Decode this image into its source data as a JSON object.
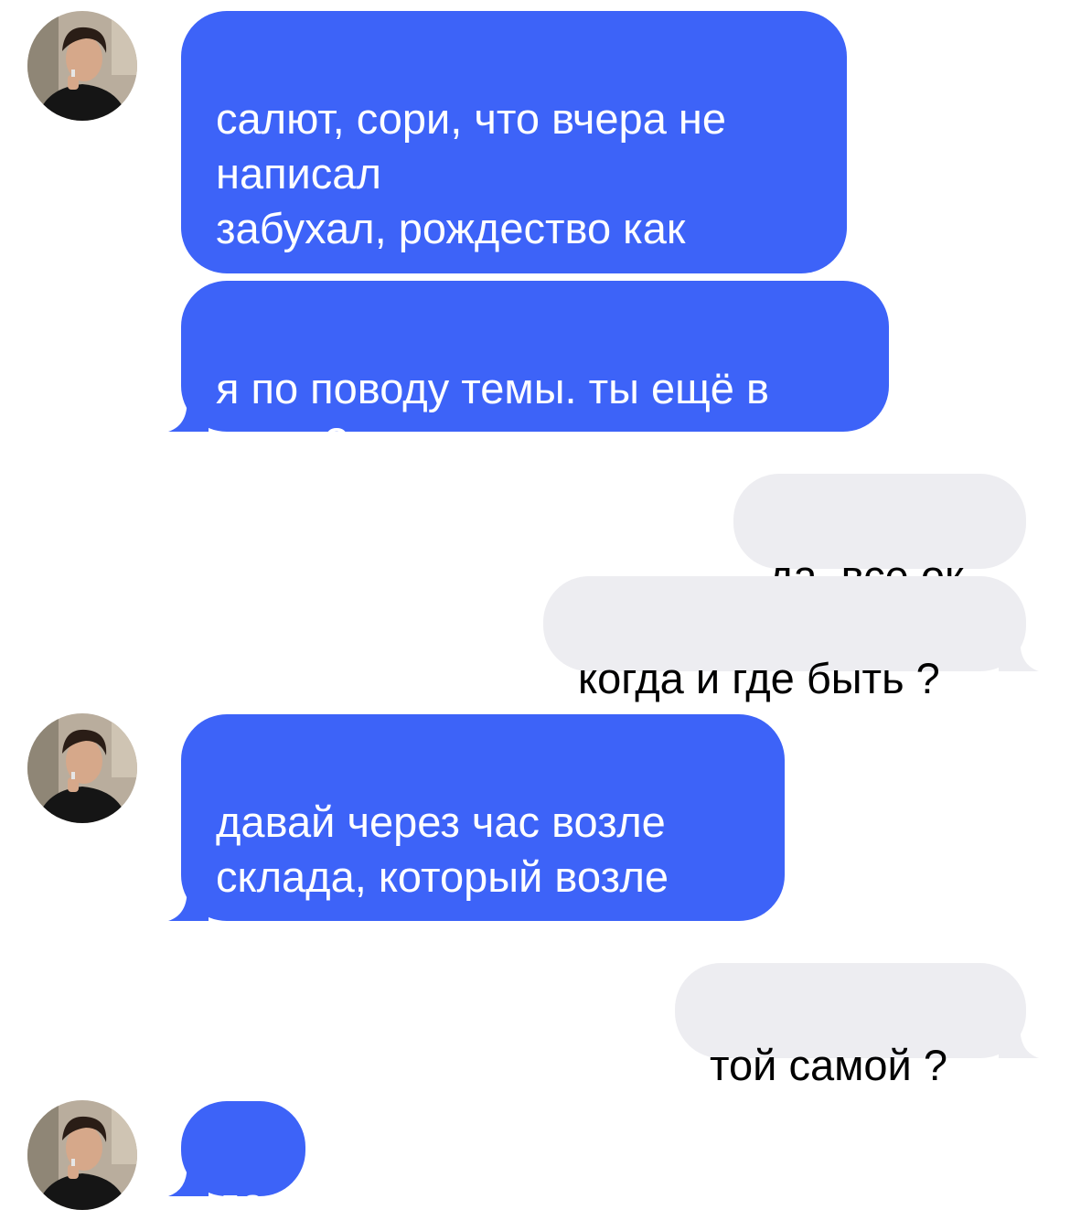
{
  "colors": {
    "incoming_bubble": "#3d63f8",
    "outgoing_bubble": "#ededf1",
    "incoming_text": "#ffffff",
    "outgoing_text": "#000000",
    "background": "#ffffff"
  },
  "contact": {
    "avatar_icon": "person-photo-avatar-icon"
  },
  "messages": [
    {
      "direction": "incoming",
      "text": "салют, сори, что вчера не\nнаписал\nзабухал, рождество как\nникак"
    },
    {
      "direction": "incoming",
      "text": "я по поводу темы. ты ещё в\nделе ?"
    },
    {
      "direction": "outgoing",
      "text": "да, все ок"
    },
    {
      "direction": "outgoing",
      "text": "когда и где быть ?"
    },
    {
      "direction": "incoming",
      "text": "давай через час возле\nсклада, который возле\nзаправки"
    },
    {
      "direction": "outgoing",
      "text": "той самой ?"
    },
    {
      "direction": "incoming",
      "text": "да"
    }
  ]
}
